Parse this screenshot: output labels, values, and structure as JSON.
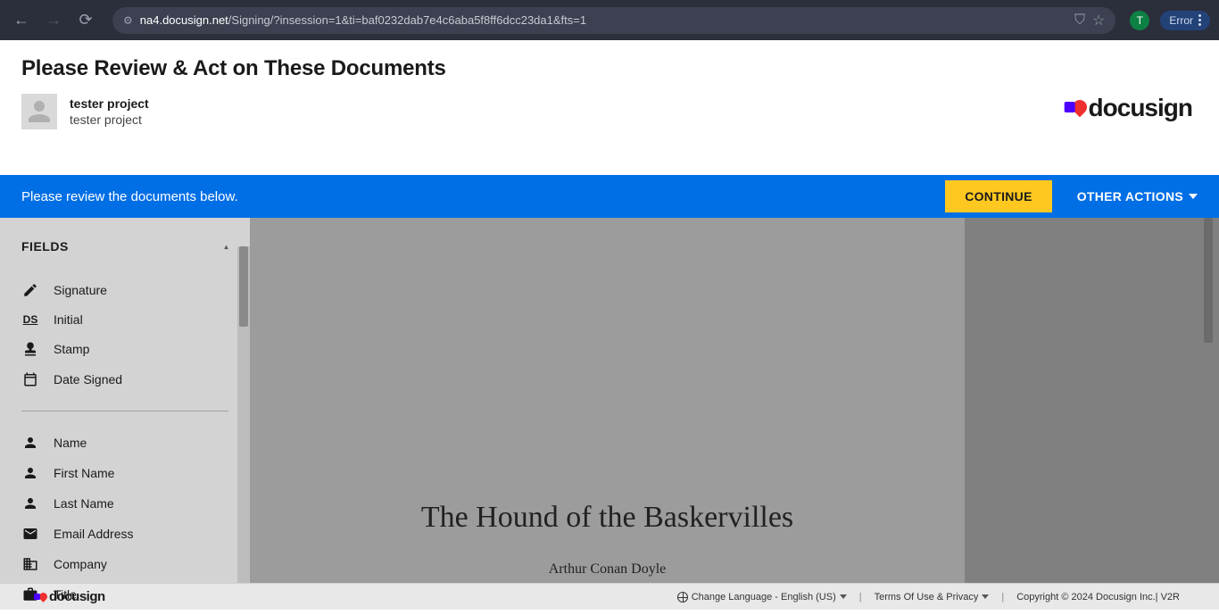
{
  "browser": {
    "url_domain": "na4.docusign.net",
    "url_path": "/Signing/?insession=1&ti=baf0232dab7e4c6aba5f8ff6dcc23da1&fts=1",
    "profile_initial": "T",
    "error_label": "Error"
  },
  "header": {
    "page_title": "Please Review & Act on These Documents",
    "sender_name": "tester project",
    "sender_sub": "tester project",
    "brand": "docusign"
  },
  "action_bar": {
    "message": "Please review the documents below.",
    "continue": "CONTINUE",
    "other_actions": "OTHER ACTIONS"
  },
  "sidebar": {
    "heading": "FIELDS",
    "group1": [
      {
        "icon": "signature",
        "label": "Signature"
      },
      {
        "icon": "initial",
        "label": "Initial"
      },
      {
        "icon": "stamp",
        "label": "Stamp"
      },
      {
        "icon": "date",
        "label": "Date Signed"
      }
    ],
    "group2": [
      {
        "icon": "person",
        "label": "Name"
      },
      {
        "icon": "person",
        "label": "First Name"
      },
      {
        "icon": "person",
        "label": "Last Name"
      },
      {
        "icon": "email",
        "label": "Email Address"
      },
      {
        "icon": "company",
        "label": "Company"
      },
      {
        "icon": "title",
        "label": "Title"
      }
    ]
  },
  "document": {
    "title": "The Hound of the Baskervilles",
    "author": "Arthur Conan Doyle"
  },
  "footer": {
    "brand": "docusign",
    "language": "Change Language - English (US)",
    "terms": "Terms Of Use & Privacy",
    "copyright": "Copyright © 2024 Docusign Inc.",
    "version": "V2R"
  }
}
